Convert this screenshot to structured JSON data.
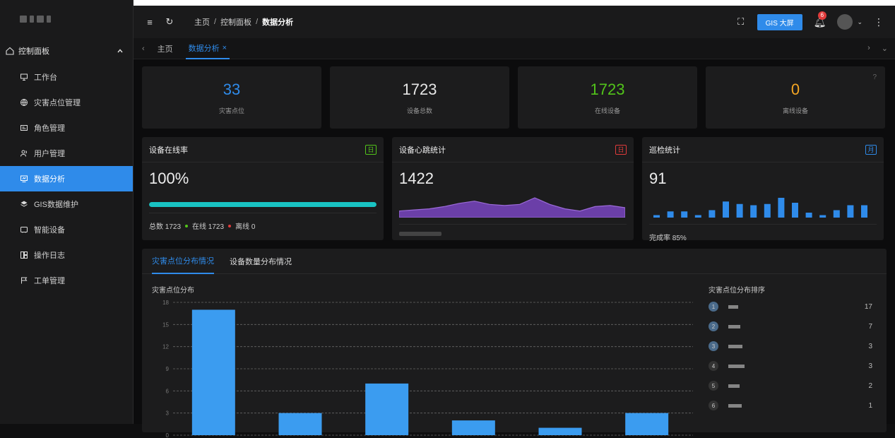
{
  "app": {
    "logo_text": ""
  },
  "sidebar": {
    "group": {
      "label": "控制面板"
    },
    "items": [
      {
        "label": "工作台",
        "icon": "monitor-icon",
        "active": false
      },
      {
        "label": "灾害点位管理",
        "icon": "globe-icon",
        "active": false
      },
      {
        "label": "角色管理",
        "icon": "id-card-icon",
        "active": false
      },
      {
        "label": "用户管理",
        "icon": "users-icon",
        "active": false
      },
      {
        "label": "数据分析",
        "icon": "chart-icon",
        "active": true
      },
      {
        "label": "GIS数据维护",
        "icon": "layers-icon",
        "active": false
      },
      {
        "label": "智能设备",
        "icon": "device-icon",
        "active": false
      },
      {
        "label": "操作日志",
        "icon": "log-icon",
        "active": false
      },
      {
        "label": "工单管理",
        "icon": "flag-icon",
        "active": false
      }
    ]
  },
  "topbar": {
    "breadcrumb": [
      "主页",
      "控制面板",
      "数据分析"
    ],
    "sep": "/",
    "gis_button": "GIS 大屏",
    "notification_count": "6"
  },
  "tabs": [
    {
      "label": "主页",
      "active": false
    },
    {
      "label": "数据分析",
      "active": true
    }
  ],
  "stats": [
    {
      "value": "33",
      "label": "灾害点位",
      "color": "#2f8bea"
    },
    {
      "value": "1723",
      "label": "设备总数",
      "color": "#e6e6e6"
    },
    {
      "value": "1723",
      "label": "在线设备",
      "color": "#52c41a"
    },
    {
      "value": "0",
      "label": "离线设备",
      "color": "#f5a623"
    }
  ],
  "online_rate": {
    "title": "设备在线率",
    "tag": "日",
    "value": "100%",
    "progress": 1.0,
    "total_label": "总数 1723",
    "online_label": "在线 1723",
    "offline_label": "离线 0"
  },
  "heartbeat": {
    "title": "设备心跳统计",
    "tag": "日",
    "value": "1422",
    "wave": [
      6,
      7,
      8,
      10,
      13,
      15,
      12,
      11,
      12,
      18,
      12,
      8,
      6,
      10,
      11,
      9
    ]
  },
  "patrol": {
    "title": "巡检统计",
    "tag": "月",
    "value": "91",
    "rate_label": "完成率 85%",
    "bars": [
      2,
      5,
      5,
      2,
      6,
      13,
      11,
      10,
      11,
      16,
      12,
      4,
      2,
      6,
      10,
      10
    ]
  },
  "bottom": {
    "tabs": [
      {
        "label": "灾害点位分布情况",
        "active": true
      },
      {
        "label": "设备数量分布情况",
        "active": false
      }
    ],
    "chart_title": "灾害点位分布",
    "rank_title": "灾害点位分布排序",
    "rank": [
      {
        "idx": "1",
        "value": "17"
      },
      {
        "idx": "2",
        "value": "7"
      },
      {
        "idx": "3",
        "value": "3"
      },
      {
        "idx": "4",
        "value": "3"
      },
      {
        "idx": "5",
        "value": "2"
      },
      {
        "idx": "6",
        "value": "1"
      }
    ]
  },
  "chart_data": {
    "type": "bar",
    "title": "灾害点位分布",
    "categories": [
      "",
      "",
      "",
      "",
      "",
      ""
    ],
    "values": [
      17,
      3,
      7,
      2,
      1,
      3
    ],
    "ylim": [
      0,
      18
    ],
    "yticks": [
      0,
      3,
      6,
      9,
      12,
      15,
      18
    ],
    "grid": true,
    "color": "#3b9cf0"
  }
}
